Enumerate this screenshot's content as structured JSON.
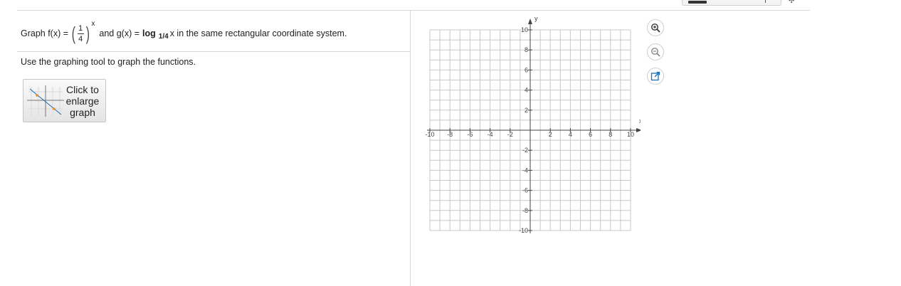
{
  "problem": {
    "prefix": "Graph f(x) =",
    "frac_num": "1",
    "frac_den": "4",
    "exponent": "x",
    "middle": "and g(x) =",
    "log_word": "log",
    "log_base": "1/4",
    "suffix": "x in the same rectangular coordinate system."
  },
  "instruction": "Use the graphing tool to graph the functions.",
  "enlarge_button": {
    "label": "Click to enlarge graph"
  },
  "graph": {
    "x_axis_label": "x",
    "y_axis_label": "y",
    "x_range": [
      -10,
      10
    ],
    "y_range": [
      -10,
      10
    ],
    "tick_step": 2,
    "grid": true,
    "x_tick_labels": [
      "-10",
      "-8",
      "-6",
      "-4",
      "-2",
      "2",
      "4",
      "6",
      "8",
      "10"
    ],
    "y_tick_labels": [
      "10",
      "8",
      "6",
      "4",
      "2",
      "-2",
      "-4",
      "-6",
      "-8",
      "-10"
    ]
  },
  "tools": [
    {
      "name": "zoom-in-button",
      "icon": "zoom-in-icon"
    },
    {
      "name": "zoom-out-button",
      "icon": "zoom-out-icon"
    },
    {
      "name": "pop-out-button",
      "icon": "external-link-icon"
    }
  ],
  "colors": {
    "accent": "#1a6fb5",
    "grid": "#c8c8c8",
    "axis": "#444444"
  }
}
